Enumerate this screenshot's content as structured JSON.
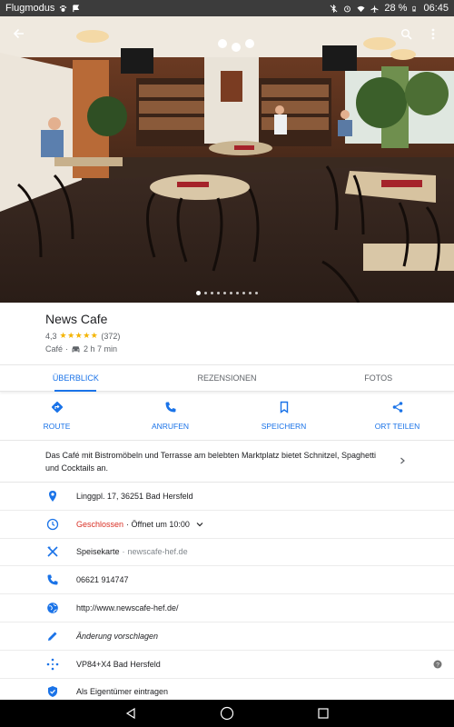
{
  "status_bar": {
    "left_text": "Flugmodus",
    "battery": "28 %",
    "time": "06:45"
  },
  "photo": {
    "dots_count": 10,
    "active_dot": 0
  },
  "place": {
    "name": "News Cafe",
    "rating": "4,3",
    "stars": "★★★★★",
    "review_count": "(372)",
    "category": "Café",
    "separator": "·",
    "drive_time": "2 h 7 min"
  },
  "tabs": [
    {
      "label": "ÜBERBLICK",
      "active": true
    },
    {
      "label": "REZENSIONEN",
      "active": false
    },
    {
      "label": "FOTOS",
      "active": false
    }
  ],
  "actions": [
    {
      "label": "ROUTE",
      "icon": "directions-icon"
    },
    {
      "label": "ANRUFEN",
      "icon": "phone-icon"
    },
    {
      "label": "SPEICHERN",
      "icon": "bookmark-icon"
    },
    {
      "label": "ORT TEILEN",
      "icon": "share-icon"
    }
  ],
  "description": "Das Café mit Bistromöbeln und Terrasse am belebten Marktplatz bietet Schnitzel, Spaghetti und Cocktails an.",
  "info": {
    "address": "Linggpl. 17, 36251 Bad Hersfeld",
    "hours_status": "Geschlossen",
    "hours_next": "· Öffnet um 10:00",
    "menu_label": "Speisekarte",
    "menu_sep": "·",
    "menu_site": "newscafe-hef.de",
    "phone": "06621 914747",
    "website": "http://www.newscafe-hef.de/",
    "suggest_edit": "Änderung vorschlagen",
    "plus_code": "VP84+X4 Bad Hersfeld",
    "claim": "Als Eigentümer eintragen"
  },
  "colors": {
    "accent": "#1a73e8",
    "closed": "#d93025",
    "star": "#f4b400"
  }
}
